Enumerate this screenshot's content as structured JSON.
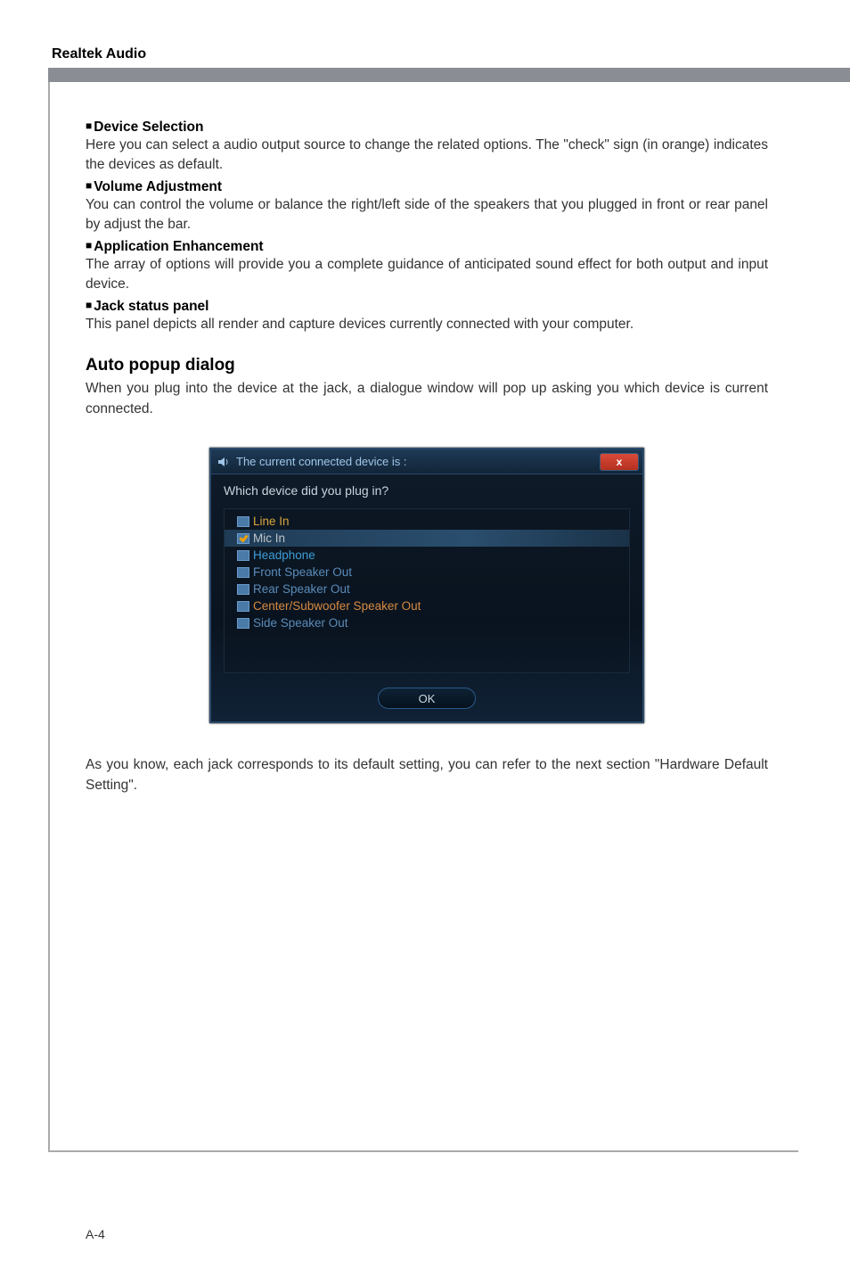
{
  "header": {
    "title": "Realtek Audio"
  },
  "sections": {
    "device_selection": {
      "heading": "Device Selection",
      "body": "Here you can select a audio output source to change the related options. The \"check\" sign (in orange) indicates the devices as default."
    },
    "volume_adjustment": {
      "heading": "Volume Adjustment",
      "body": "You can control the volume or balance the right/left side of the speakers that you plugged in front or rear panel by adjust the bar."
    },
    "application_enhancement": {
      "heading": "Application Enhancement",
      "body": "The array of options will provide you a complete guidance of anticipated sound effect for both output and input device."
    },
    "jack_status": {
      "heading": "Jack status panel",
      "body": "This panel depicts all render and capture devices currently connected with your computer."
    },
    "auto_popup": {
      "heading": "Auto popup dialog",
      "intro": "When you plug into the device at the jack, a dialogue window will pop up asking you which device is current connected.",
      "outro": "As you know, each jack corresponds to its default setting, you can refer to the next section \"Hardware Default Setting\"."
    }
  },
  "dialog": {
    "title": "The current connected device is :",
    "prompt": "Which device did you plug in?",
    "close_glyph": "x",
    "devices": {
      "linein": "Line In",
      "micin": "Mic In",
      "headphone": "Headphone",
      "front": "Front Speaker Out",
      "rear": "Rear Speaker Out",
      "center": "Center/Subwoofer Speaker Out",
      "side": "Side Speaker Out"
    },
    "selected": "micin",
    "ok_label": "OK"
  },
  "footer": {
    "page": "A-4"
  }
}
